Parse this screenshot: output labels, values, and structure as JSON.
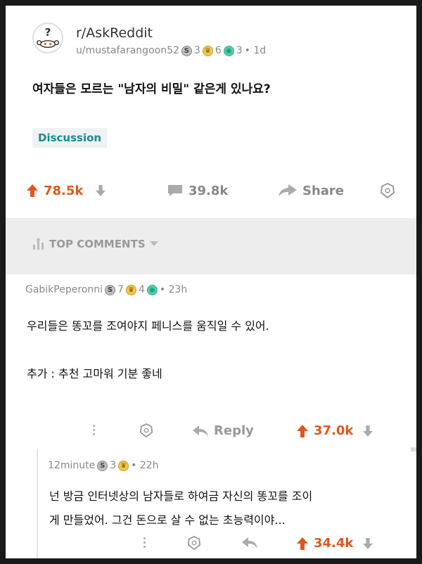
{
  "post": {
    "subreddit": "r/AskReddit",
    "username": "u/mustafarangoon52",
    "award_counts": [
      "3",
      "6",
      "3"
    ],
    "age": "• 1d",
    "title": "여자들은 모르는 \"남자의 비밀\" 같은게 있나요?",
    "flair": "Discussion",
    "upvotes": "78.5k",
    "comments": "39.8k",
    "share_label": "Share"
  },
  "sort": {
    "label": "TOP COMMENTS"
  },
  "comment1": {
    "username": "GabikPeperonni",
    "award_counts": [
      "7",
      "4"
    ],
    "age": "• 23h",
    "body1": "우리들은 똥꼬를 조여야지 페니스를 움직일 수 있어.",
    "body2": "추가 : 추천 고마워 기분 좋네",
    "reply_label": "Reply",
    "upvotes": "37.0k"
  },
  "comment2": {
    "username": "12minute",
    "award_counts": [
      "3"
    ],
    "age": "• 22h",
    "body1": "넌 방금 인터넷상의 남자들로 하여금 자신의 똥꼬를 조이",
    "body2": "게 만들었어. 그건 돈으로 살 수 없는 초능력이야...",
    "upvotes": "34.4k"
  },
  "colors": {
    "upvote": "#e0571d",
    "flair_text": "#1a8a8a",
    "muted": "#888888"
  }
}
